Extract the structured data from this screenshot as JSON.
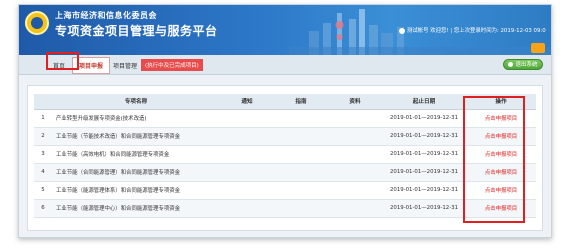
{
  "header": {
    "org_name": "上海市经济和信息化委员会",
    "system_title": "专项资金项目管理与服务平台",
    "user_info": "测试帐号 欢迎您! | 您上次登录时间为: 2019-12-03 09:0"
  },
  "nav": {
    "items": [
      {
        "label": "首页"
      },
      {
        "label": "项目申报"
      },
      {
        "label": "项目管理"
      }
    ],
    "note": "(执行中及已完成项目)",
    "logout": "退出系统"
  },
  "table": {
    "columns": [
      "",
      "专项名称",
      "通知",
      "指南",
      "资料",
      "起止日期",
      "操作"
    ],
    "rows": [
      {
        "num": "1",
        "name": "产业转型升级发展专项资金(技术改造)",
        "period": "2019-01-01—2019-12-31",
        "action": "点击申报项目"
      },
      {
        "num": "2",
        "name": "工业节能（节能技术改造）和合同能源管理专项资金",
        "period": "2019-01-01—2019-12-31",
        "action": "点击申报项目"
      },
      {
        "num": "3",
        "name": "工业节能（高效电机）和合同能源管理专项资金",
        "period": "2019-01-01—2019-12-31",
        "action": "点击申报项目"
      },
      {
        "num": "4",
        "name": "工业节能（合同能源管理）和合同能源管理专项资金",
        "period": "2019-01-01—2019-12-31",
        "action": "点击申报项目"
      },
      {
        "num": "5",
        "name": "工业节能（能源管理体系）和合同能源管理专项资金",
        "period": "2019-01-01—2019-12-31",
        "action": "点击申报项目"
      },
      {
        "num": "6",
        "name": "工业节能（能源管理中心）和合同能源管理专项资金",
        "period": "2019-01-01—2019-12-31",
        "action": "点击申报项目"
      }
    ]
  },
  "colors": {
    "header_blue": "#2d78c8",
    "highlight_red": "#e02020",
    "logout_green": "#4ea83a"
  }
}
